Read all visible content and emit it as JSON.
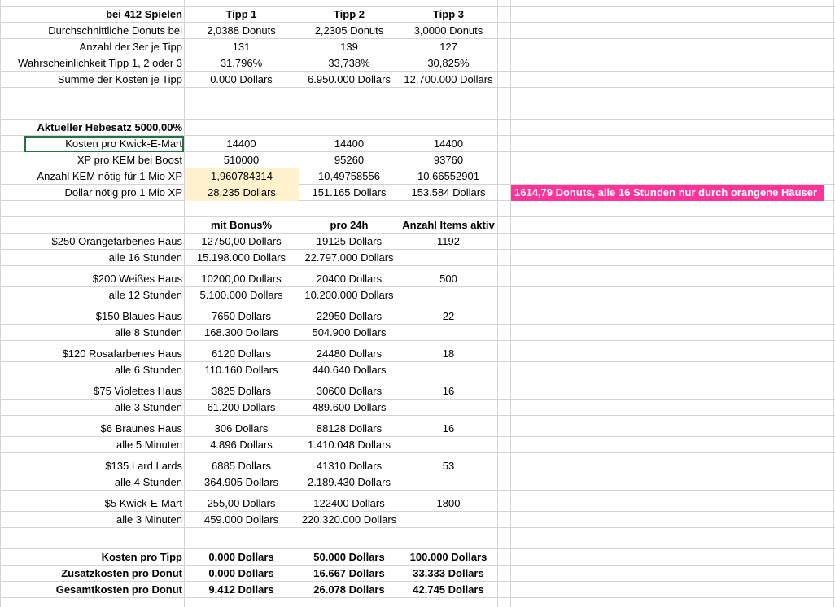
{
  "header": {
    "label": "bei 412 Spielen",
    "tipp1": "Tipp 1",
    "tipp2": "Tipp 2",
    "tipp3": "Tipp 3"
  },
  "summary_rows": [
    {
      "label": "Durchschnittliche Donuts bei",
      "t1": "2,0388 Donuts",
      "t2": "2,2305 Donuts",
      "t3": "3,0000 Donuts"
    },
    {
      "label": "Anzahl der 3er je Tipp",
      "t1": "131",
      "t2": "139",
      "t3": "127"
    },
    {
      "label": "Wahrscheinlichkeit Tipp 1, 2 oder 3",
      "t1": "31,796%",
      "t2": "33,738%",
      "t3": "30,825%"
    },
    {
      "label": "Summe der Kosten je Tipp",
      "t1": "0.000 Dollars",
      "t2": "6.950.000 Dollars",
      "t3": "12.700.000 Dollars"
    }
  ],
  "hebesatz": "Aktueller Hebesatz 5000,00%",
  "kem_rows": [
    {
      "label": "Kosten pro Kwick-E-Mart",
      "t1": "14400",
      "t2": "14400",
      "t3": "14400"
    },
    {
      "label": "XP pro KEM bei Boost",
      "t1": "510000",
      "t2": "95260",
      "t3": "93760"
    },
    {
      "label": "Anzahl KEM nötig für 1 Mio XP",
      "t1": "1,960784314",
      "t2": "10,49758556",
      "t3": "10,66552901"
    },
    {
      "label": "Dollar nötig pro 1 Mio XP",
      "t1": "28.235 Dollars",
      "t2": "151.165 Dollars",
      "t3": "153.584 Dollars"
    }
  ],
  "pink_note": "1614,79  Donuts, alle 16 Stunden nur durch orangene Häuser",
  "items_header": {
    "bonus": "mit Bonus%",
    "per24": "pro 24h",
    "active": "Anzahl Items aktiv"
  },
  "items": [
    {
      "name": "$250 Orangefarbenes Haus",
      "bonus": "12750,00 Dollars",
      "per24": "19125 Dollars",
      "active": "1192",
      "interval": "alle 16 Stunden",
      "bonus2": "15.198.000 Dollars",
      "per24_2": "22.797.000 Dollars"
    },
    {
      "name": "$200 Weißes Haus",
      "bonus": "10200,00 Dollars",
      "per24": "20400 Dollars",
      "active": "500",
      "interval": "alle 12 Stunden",
      "bonus2": "5.100.000 Dollars",
      "per24_2": "10.200.000 Dollars"
    },
    {
      "name": "$150 Blaues Haus",
      "bonus": "7650 Dollars",
      "per24": "22950 Dollars",
      "active": "22",
      "interval": "alle 8 Stunden",
      "bonus2": "168.300 Dollars",
      "per24_2": "504.900 Dollars"
    },
    {
      "name": "$120 Rosafarbenes Haus",
      "bonus": "6120 Dollars",
      "per24": "24480 Dollars",
      "active": "18",
      "interval": "alle 6 Stunden",
      "bonus2": "110.160 Dollars",
      "per24_2": "440.640 Dollars"
    },
    {
      "name": "$75 Violettes Haus",
      "bonus": "3825 Dollars",
      "per24": "30600 Dollars",
      "active": "16",
      "interval": "alle 3 Stunden",
      "bonus2": "61.200 Dollars",
      "per24_2": "489.600 Dollars"
    },
    {
      "name": "$6 Braunes Haus",
      "bonus": "306 Dollars",
      "per24": "88128 Dollars",
      "active": "16",
      "interval": "alle 5 Minuten",
      "bonus2": "4.896 Dollars",
      "per24_2": "1.410.048 Dollars"
    },
    {
      "name": "$135 Lard Lards",
      "bonus": "6885 Dollars",
      "per24": "41310 Dollars",
      "active": "53",
      "interval": "alle 4 Stunden",
      "bonus2": "364.905 Dollars",
      "per24_2": "2.189.430 Dollars"
    },
    {
      "name": "$5 Kwick-E-Mart",
      "bonus": "255,00 Dollars",
      "per24": "122400 Dollars",
      "active": "1800",
      "interval": "alle 3 Minuten",
      "bonus2": "459.000 Dollars",
      "per24_2": "220.320.000 Dollars"
    }
  ],
  "totals": [
    {
      "label": "Kosten pro Tipp",
      "t1": "0.000 Dollars",
      "t2": "50.000 Dollars",
      "t3": "100.000 Dollars"
    },
    {
      "label": "Zusatzkosten pro Donut",
      "t1": "0.000 Dollars",
      "t2": "16.667 Dollars",
      "t3": "33.333 Dollars"
    },
    {
      "label": "Gesamtkosten pro Donut",
      "t1": "9.412 Dollars",
      "t2": "26.078 Dollars",
      "t3": "42.745 Dollars"
    }
  ],
  "colors": {
    "highlight": "#fff2cc",
    "pink": "#ff3399",
    "selection": "#217346",
    "grid": "#d4d4d4"
  }
}
